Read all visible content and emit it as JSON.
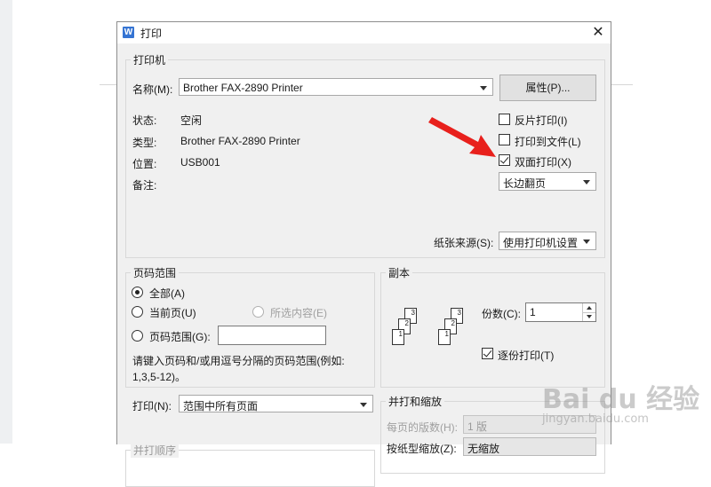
{
  "window": {
    "title": "打印",
    "app_icon": "W",
    "close_glyph": "✕"
  },
  "printer": {
    "group_label": "打印机",
    "name_label": "名称(M):",
    "name_value": "Brother FAX-2890 Printer",
    "properties_button": "属性(P)...",
    "status_label": "状态:",
    "status_value": "空闲",
    "type_label": "类型:",
    "type_value": "Brother FAX-2890 Printer",
    "location_label": "位置:",
    "location_value": "USB001",
    "comment_label": "备注:",
    "comment_value": "",
    "options": [
      {
        "label": "反片打印(I)",
        "checked": false
      },
      {
        "label": "打印到文件(L)",
        "checked": false
      },
      {
        "label": "双面打印(X)",
        "checked": true
      }
    ],
    "duplex_mode": "长边翻页",
    "paper_source_label": "纸张来源(S):",
    "paper_source_value": "使用打印机设置"
  },
  "page_range": {
    "group_label": "页码范围",
    "all_label": "全部(A)",
    "current_label": "当前页(U)",
    "selection_label": "所选内容(E)",
    "pages_label": "页码范围(G):",
    "pages_value": "",
    "hint": "请键入页码和/或用逗号分隔的页码范围(例如:",
    "hint_example": "1,3,5-12)。",
    "selected": "all"
  },
  "copies": {
    "group_label": "副本",
    "count_label": "份数(C):",
    "count_value": "1",
    "collate_label": "逐份打印(T)",
    "collate_checked": true,
    "stack_labels": [
      "1",
      "2",
      "3"
    ]
  },
  "print_what": {
    "label": "打印(N):",
    "value": "范围中所有页面",
    "order_label": "并打顺序"
  },
  "zoom": {
    "group_label": "并打和缩放",
    "pages_per_sheet_label": "每页的版数(H):",
    "pages_per_sheet_value": "1 版",
    "scale_label": "按纸型缩放(Z):",
    "scale_value": "无缩放"
  },
  "annotation": {
    "arrow_color": "#e8201c"
  },
  "watermark": {
    "main": "Bai du 经验",
    "sub": "jingyan.baidu.com"
  }
}
